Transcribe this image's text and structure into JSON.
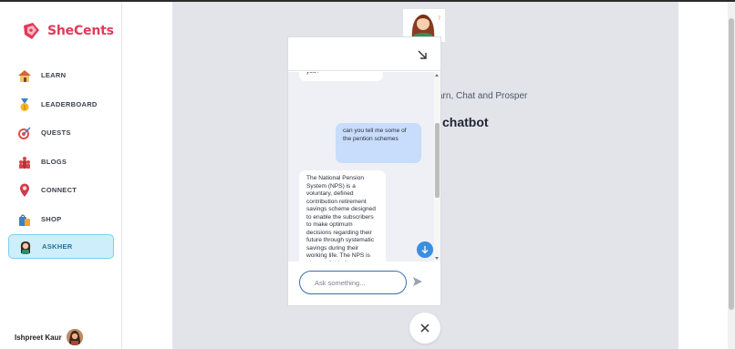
{
  "brand": {
    "name": "SheCents",
    "color": "#e13a59"
  },
  "nav": [
    {
      "label": "LEARN",
      "icon": "house-icon"
    },
    {
      "label": "LEADERBOARD",
      "icon": "medal-icon"
    },
    {
      "label": "QUESTS",
      "icon": "target-icon"
    },
    {
      "label": "BLOGS",
      "icon": "people-icon"
    },
    {
      "label": "CONNECT",
      "icon": "person-pin-icon"
    },
    {
      "label": "SHOP",
      "icon": "shopping-bag-icon"
    },
    {
      "label": "ASKHER",
      "icon": "woman-avatar-icon",
      "active": true
    }
  ],
  "user": {
    "name": "Ishpreet Kaur"
  },
  "main": {
    "tagline": "arn, Chat and Prosper",
    "heading": "chatbot"
  },
  "chat": {
    "messages": [
      {
        "from": "bot",
        "text": "you?"
      },
      {
        "from": "user",
        "text": "can you tell me some of the pention schemes"
      },
      {
        "from": "bot",
        "text": "The National Pension System (NPS) is a voluntary, defined contribution retirement savings scheme designed to enable the subscribers to make optimum decisions regarding their future through systematic savings during their working life. The NPS is also available for government employees and the"
      }
    ],
    "input_placeholder": "Ask something..."
  },
  "colors": {
    "accent": "#3a8fe0",
    "user_bubble": "#c8dcfb",
    "active_nav": "#cdeefa"
  }
}
